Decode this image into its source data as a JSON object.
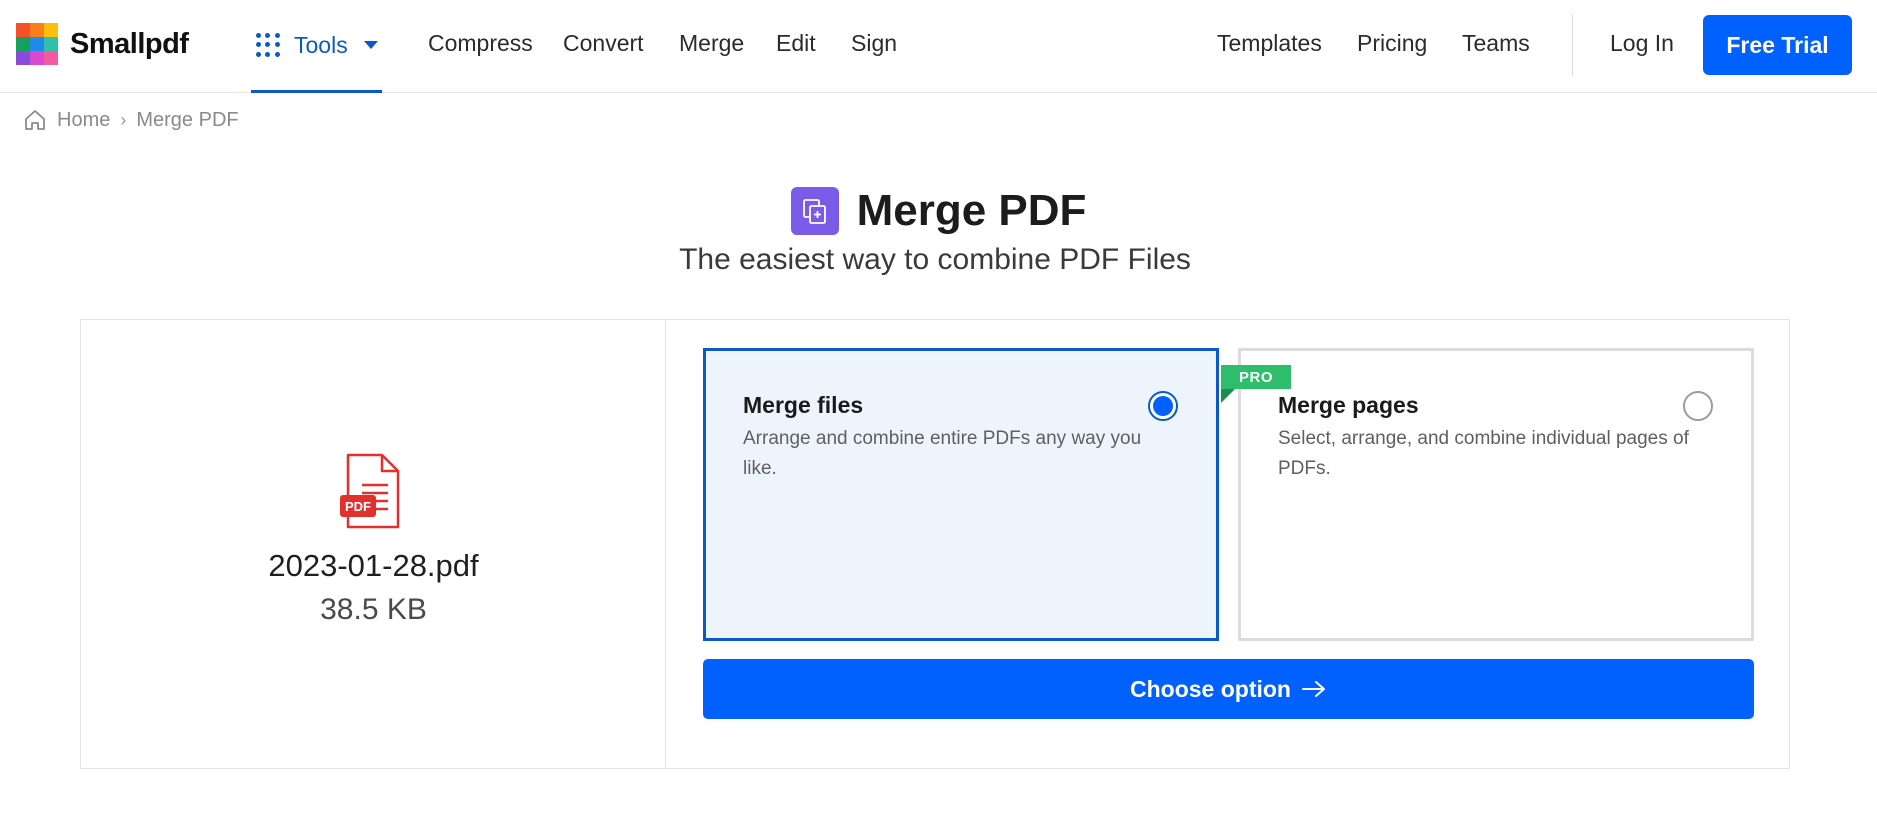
{
  "header": {
    "logo_text": "Smallpdf",
    "tools_label": "Tools",
    "nav_left": [
      "Compress",
      "Convert",
      "Merge",
      "Edit",
      "Sign"
    ],
    "nav_right": [
      "Templates",
      "Pricing",
      "Teams"
    ],
    "login_label": "Log In",
    "trial_label": "Free Trial"
  },
  "breadcrumb": {
    "home": "Home",
    "separator": "›",
    "current": "Merge PDF"
  },
  "page": {
    "title": "Merge PDF",
    "subtitle": "The easiest way to combine PDF Files"
  },
  "file": {
    "badge": "PDF",
    "name": "2023-01-28.pdf",
    "size": "38.5 KB"
  },
  "options": [
    {
      "title": "Merge files",
      "description": "Arrange and combine entire PDFs any way you like.",
      "selected": true
    },
    {
      "title": "Merge pages",
      "description": "Select, arrange, and combine individual pages of PDFs.",
      "selected": false,
      "badge": "PRO"
    }
  ],
  "action": {
    "label": "Choose option"
  },
  "colors": {
    "primary": "#0061fe",
    "accent_blue": "#0a58ca",
    "pro_green": "#2ebd6b",
    "title_icon": "#7a5be8",
    "pdf_red": "#e0312e"
  },
  "icons": {
    "logo": "smallpdf-logo-icon",
    "tools": "grid-dots-icon",
    "home": "home-icon",
    "title": "merge-icon",
    "file": "pdf-file-icon",
    "action": "arrow-right-icon"
  }
}
